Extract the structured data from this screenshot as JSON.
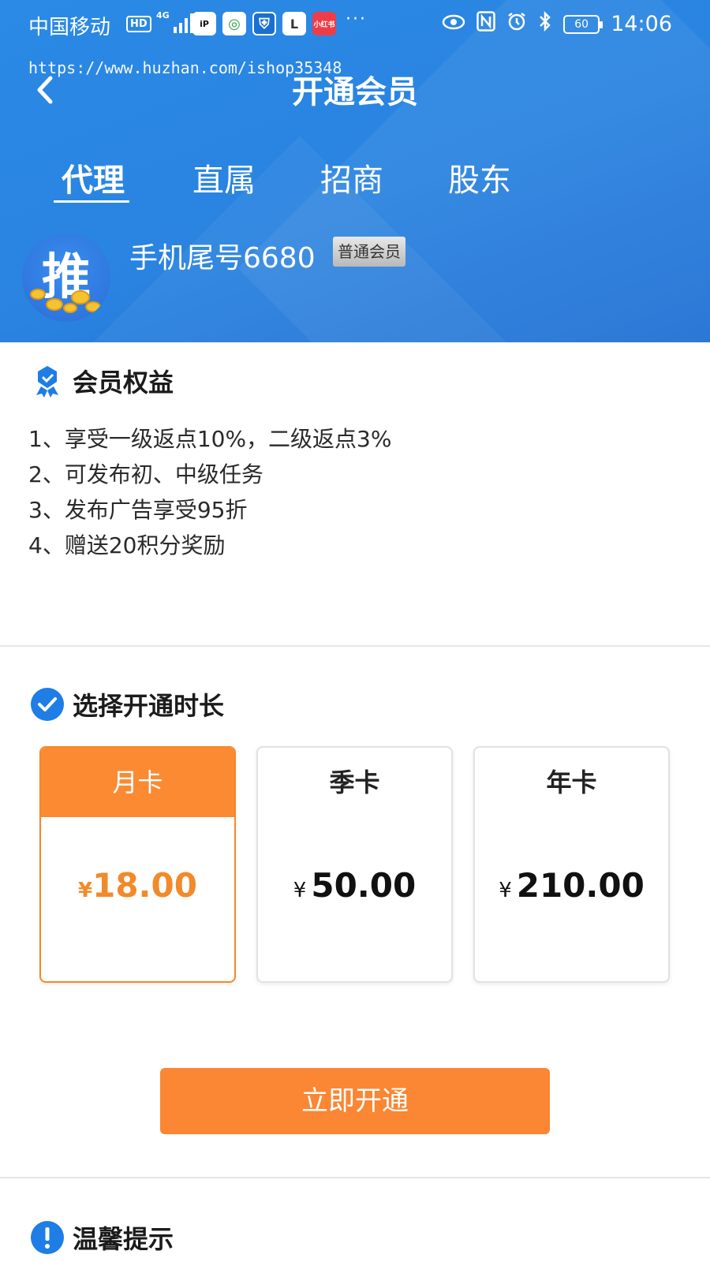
{
  "status_bar": {
    "carrier": "中国移动",
    "hd": "HD",
    "network": "4G",
    "app_icons": [
      "iP",
      "◎",
      "⛨",
      "L",
      "小红书"
    ],
    "overflow": "···",
    "battery": "60",
    "time": "14:06"
  },
  "watermark": "https://www.huzhan.com/ishop35348",
  "header": {
    "title": "开通会员"
  },
  "tabs": [
    {
      "label": "代理",
      "active": true
    },
    {
      "label": "直属",
      "active": false
    },
    {
      "label": "招商",
      "active": false
    },
    {
      "label": "股东",
      "active": false
    }
  ],
  "user": {
    "avatar_char": "推",
    "name": "手机尾号6680",
    "level": "普通会员"
  },
  "benefits": {
    "title": "会员权益",
    "items": [
      "1、享受一级返点10%，二级返点3%",
      "2、可发布初、中级任务",
      "3、发布广告享受95折",
      "4、赠送20积分奖励"
    ]
  },
  "duration": {
    "title": "选择开通时长",
    "options": [
      {
        "label": "月卡",
        "currency": "¥",
        "price": "18.00",
        "selected": true
      },
      {
        "label": "季卡",
        "currency": "¥",
        "price": "50.00",
        "selected": false
      },
      {
        "label": "年卡",
        "currency": "¥",
        "price": "210.00",
        "selected": false
      }
    ]
  },
  "actions": {
    "open_label": "立即开通"
  },
  "tips": {
    "title": "温馨提示"
  },
  "colors": {
    "header_blue": "#2a83e0",
    "accent_orange": "#fb8633",
    "icon_blue": "#1f7de6"
  }
}
